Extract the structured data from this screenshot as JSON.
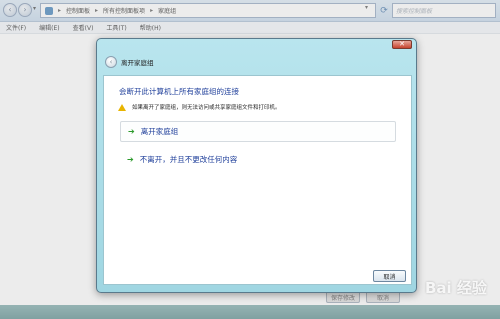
{
  "address_bar": {
    "back_icon": "back-arrow-icon",
    "forward_icon": "forward-arrow-icon",
    "breadcrumbs": [
      "控制面板",
      "所有控制面板项",
      "家庭组"
    ],
    "search_placeholder": "搜索控制面板"
  },
  "menu": {
    "items": [
      "文件(F)",
      "编辑(E)",
      "查看(V)",
      "工具(T)",
      "帮助(H)"
    ]
  },
  "dialog": {
    "title": "离开家庭组",
    "heading": "会断开此计算机上所有家庭组的连接",
    "warning": "如果离开了家庭组，则无法访问或共享家庭组文件和打印机。",
    "option_leave": "离开家庭组",
    "option_stay": "不离开，并且不更改任何内容",
    "cancel_label": "取消"
  },
  "background_buttons": {
    "save_label": "保存修改",
    "cancel_label": "取消"
  },
  "watermark": "Bai 经验"
}
